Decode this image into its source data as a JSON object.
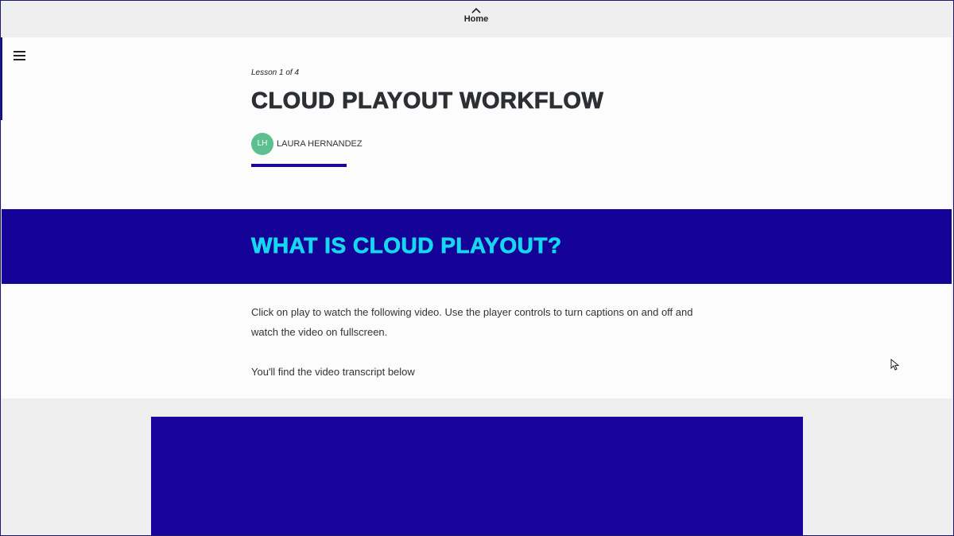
{
  "nav": {
    "home_label": "Home"
  },
  "lesson": {
    "count": "Lesson 1 of 4",
    "title": "CLOUD PLAYOUT WORKFLOW",
    "author_initials": "LH",
    "author_name": "LAURA HERNANDEZ"
  },
  "section": {
    "heading": "WHAT IS CLOUD PLAYOUT?",
    "paragraph_1": "Click on play to watch the following video. Use the player controls to turn captions on and off and watch the video on fullscreen.",
    "paragraph_2": "You'll find the video transcript below"
  },
  "colors": {
    "accent": "#150296",
    "heading_cyan": "#17d6f0",
    "avatar": "#5bbf8f"
  },
  "icons": {
    "home": "chevron-up-icon",
    "menu": "hamburger-menu-icon"
  }
}
